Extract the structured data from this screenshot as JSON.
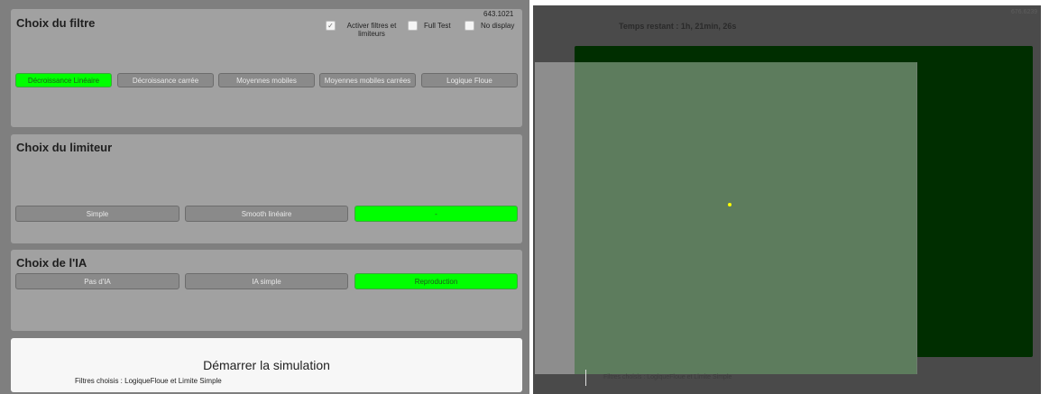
{
  "left_panel": {
    "counter": "643.1021",
    "filter_section": {
      "title": "Choix du filtre",
      "options": [
        {
          "label": "Activer filtres et limiteurs",
          "checked": true
        },
        {
          "label": "Full Test",
          "checked": false
        },
        {
          "label": "No display",
          "checked": false
        }
      ],
      "buttons": [
        {
          "label": "Décroissance Linéaire",
          "active": true
        },
        {
          "label": "Décroissance carrée",
          "active": false
        },
        {
          "label": "Moyennes mobiles",
          "active": false
        },
        {
          "label": "Moyennes mobiles carrées",
          "active": false
        },
        {
          "label": "Logique Floue",
          "active": false
        }
      ]
    },
    "limiter_section": {
      "title": "Choix du limiteur",
      "buttons": [
        {
          "label": "Simple",
          "active": false
        },
        {
          "label": "Smooth linéaire",
          "active": false
        },
        {
          "label": "-",
          "active": true
        }
      ]
    },
    "ai_section": {
      "title": "Choix de l'IA",
      "buttons": [
        {
          "label": "Pas d'IA",
          "active": false
        },
        {
          "label": "IA simple",
          "active": false
        },
        {
          "label": "Reproduction",
          "active": true
        }
      ]
    },
    "start_section": {
      "button_label": "Démarrer la simulation",
      "chosen_filters": "Filtres choisis : LogiqueFloue et Limite Simple"
    }
  },
  "right_panel": {
    "counter": "676.6239",
    "remaining_time": "Temps restant : 1h, 21min, 26s",
    "chosen_filters": "Filtres choisis : LogiqueFloue et Limite Simple"
  },
  "colors": {
    "active_green": "#00ff00",
    "board_dark_green": "#002e00",
    "overlay_green": "#5d7c5d",
    "point_yellow": "#ffff00"
  }
}
